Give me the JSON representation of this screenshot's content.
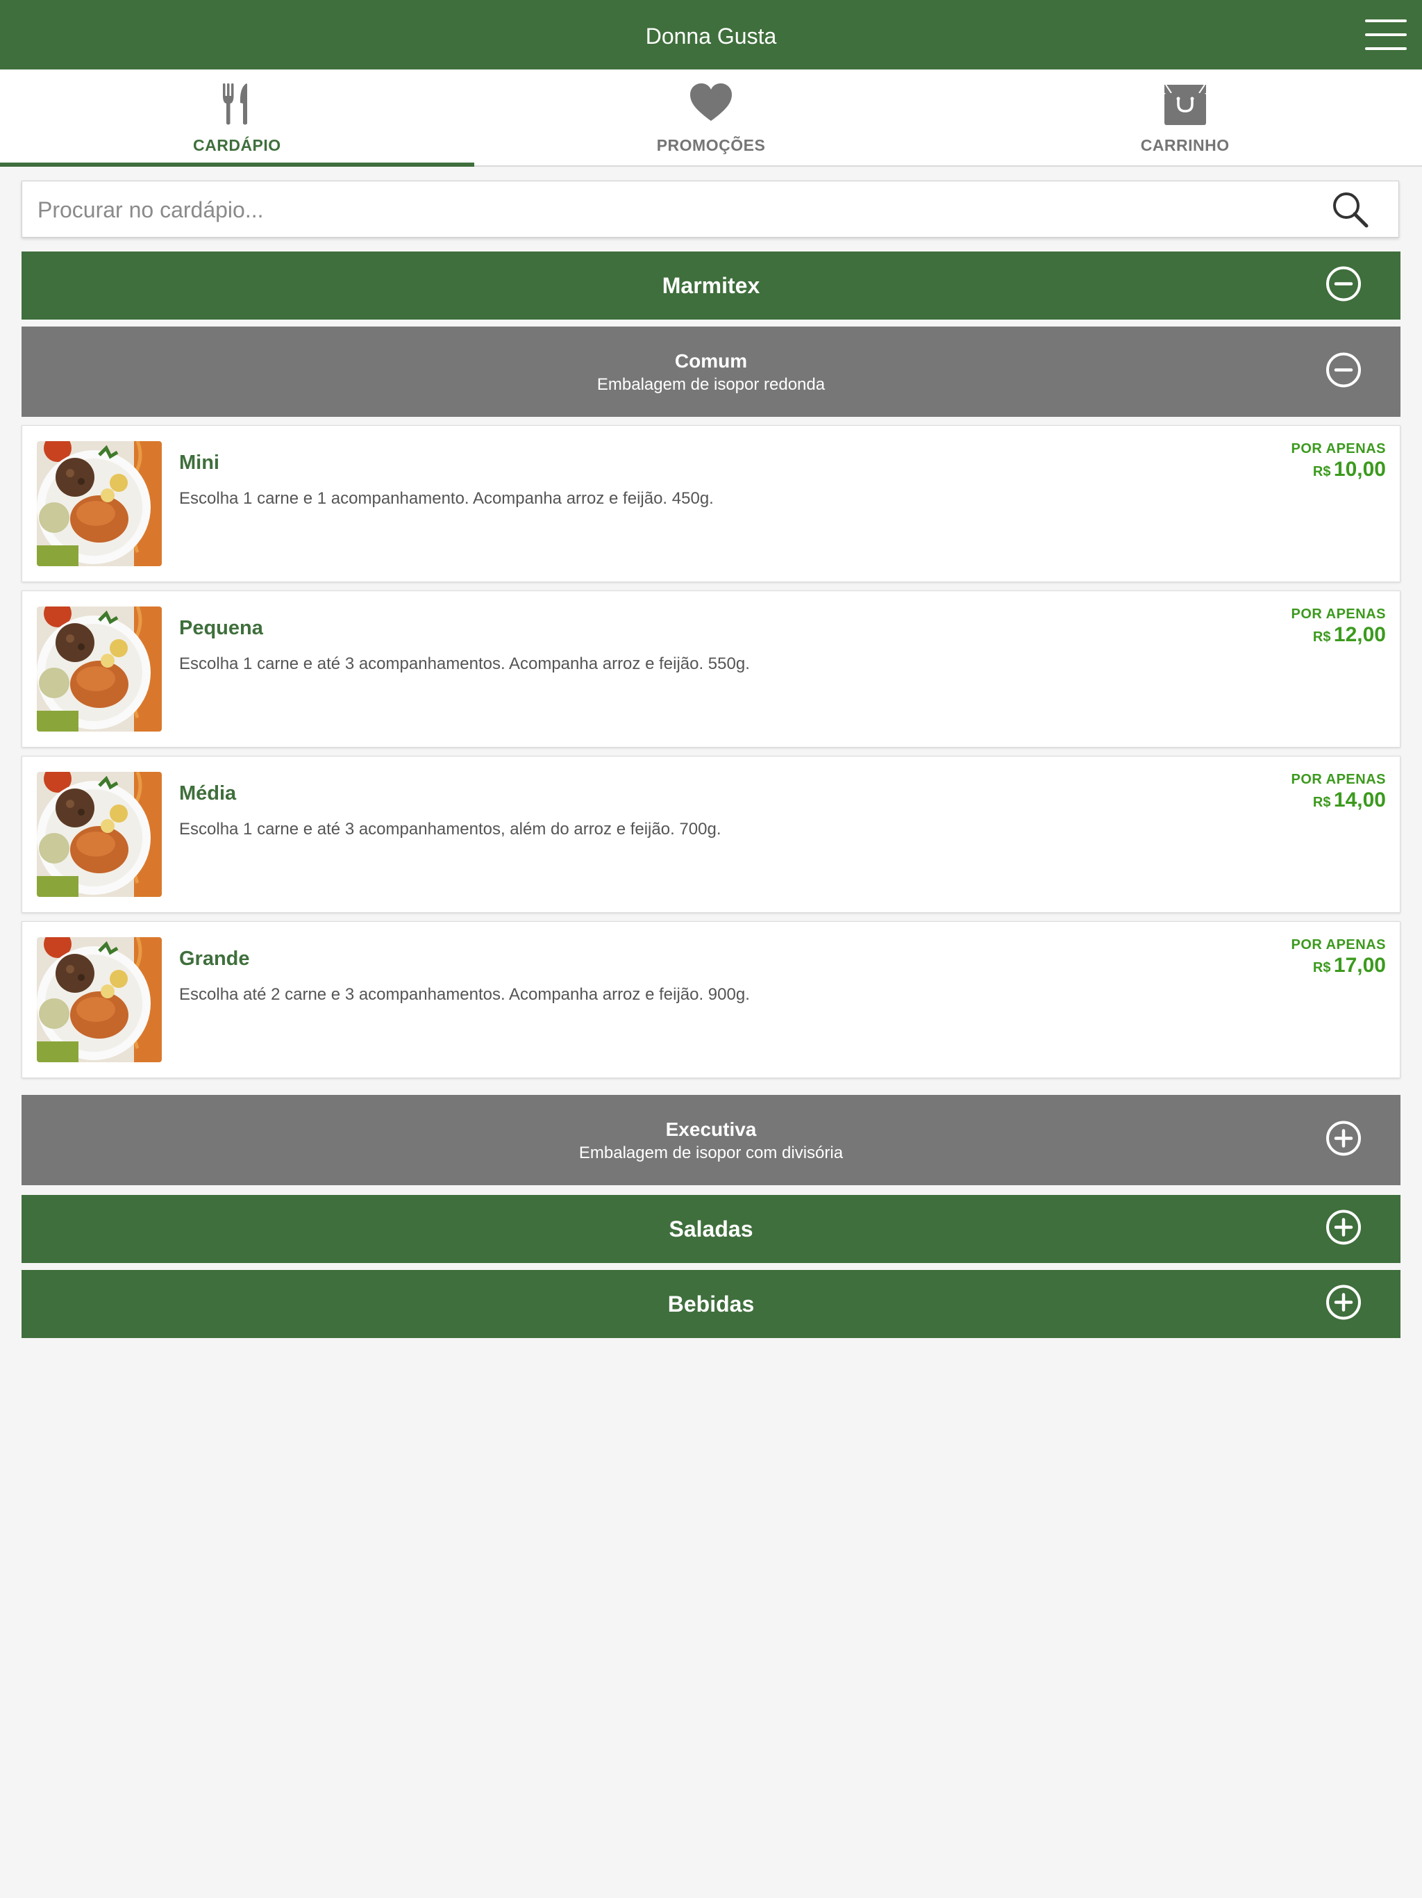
{
  "header": {
    "title": "Donna Gusta"
  },
  "tabs": [
    {
      "label": "CARDÁPIO",
      "icon": "fork-knife-icon",
      "active": true
    },
    {
      "label": "PROMOÇÕES",
      "icon": "heart-icon",
      "active": false
    },
    {
      "label": "CARRINHO",
      "icon": "shopping-bag-icon",
      "active": false
    }
  ],
  "search": {
    "placeholder": "Procurar no cardápio...",
    "value": ""
  },
  "categories": {
    "marmitex": {
      "title": "Marmitex",
      "expanded": true
    },
    "comum": {
      "title": "Comum",
      "subtitle": "Embalagem de isopor redonda",
      "expanded": true
    },
    "executiva": {
      "title": "Executiva",
      "subtitle": "Embalagem de isopor com divisória",
      "expanded": false
    },
    "saladas": {
      "title": "Saladas",
      "expanded": false
    },
    "bebidas": {
      "title": "Bebidas",
      "expanded": false
    }
  },
  "items": [
    {
      "name": "Mini",
      "description": "Escolha 1 carne e 1 acompanhamento. Acompanha arroz e feijão. 450g.",
      "price_prefix": "POR APENAS",
      "currency": "R$",
      "price": "10,00"
    },
    {
      "name": "Pequena",
      "description": "Escolha 1 carne e até 3 acompanhamentos. Acompanha arroz e feijão. 550g.",
      "price_prefix": "POR APENAS",
      "currency": "R$",
      "price": "12,00"
    },
    {
      "name": "Média",
      "description": "Escolha 1 carne e até 3 acompanhamentos, além do arroz e feijão. 700g.",
      "price_prefix": "POR APENAS",
      "currency": "R$",
      "price": "14,00"
    },
    {
      "name": "Grande",
      "description": "Escolha até 2 carne e 3 acompanhamentos. Acompanha arroz e feijão. 900g.",
      "price_prefix": "POR APENAS",
      "currency": "R$",
      "price": "17,00"
    }
  ],
  "colors": {
    "primary_green": "#3f6f3c",
    "subcategory_gray": "#777777",
    "price_green": "#3c9a1e",
    "background": "#f5f5f5"
  }
}
